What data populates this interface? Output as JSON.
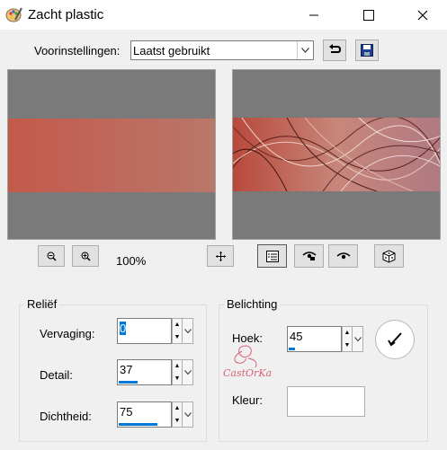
{
  "window": {
    "title": "Zacht plastic",
    "icon": "paint-palette-icon",
    "controls": [
      "minimize-icon",
      "maximize-icon",
      "close-icon"
    ]
  },
  "presets": {
    "label": "Voorinstellingen:",
    "value": "Laatst gebruikt"
  },
  "zoom": {
    "level": "100%"
  },
  "relief": {
    "title": "Reliëf",
    "vervaging": {
      "label": "Vervaging:",
      "value": "0",
      "fill": 0.0
    },
    "detail": {
      "label": "Detail:",
      "value": "37",
      "fill": 0.37
    },
    "dichtheid": {
      "label": "Dichtheid:",
      "value": "75",
      "fill": 0.75
    }
  },
  "lighting": {
    "title": "Belichting",
    "hoek": {
      "label": "Hoek:",
      "value": "45",
      "fill": 0.125
    },
    "kleur": {
      "label": "Kleur:",
      "color": "#ffffff"
    }
  },
  "watermark": {
    "text": "CastOrKa"
  },
  "colors": {
    "accent": "#0078d7",
    "preview_band": "#c0665a",
    "preview_bg": "#7a7a7a"
  }
}
